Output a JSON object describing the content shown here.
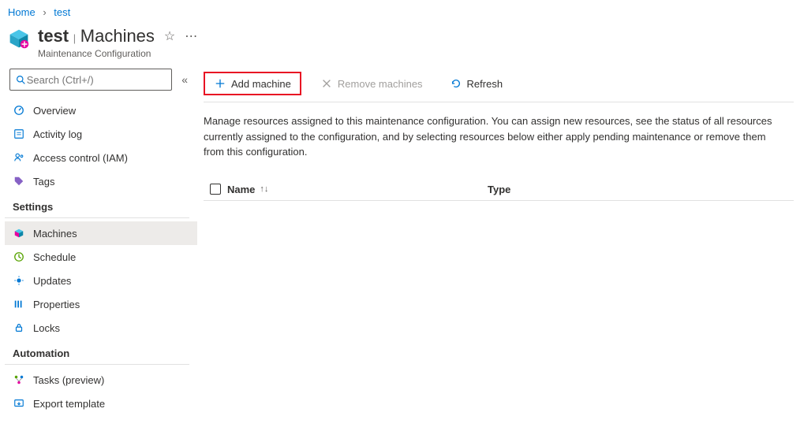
{
  "breadcrumb": {
    "home": "Home",
    "current": "test"
  },
  "header": {
    "resource_name": "test",
    "blade_name": "Machines",
    "subtitle": "Maintenance Configuration"
  },
  "search": {
    "placeholder": "Search (Ctrl+/)"
  },
  "sidebar": {
    "items": [
      {
        "label": "Overview"
      },
      {
        "label": "Activity log"
      },
      {
        "label": "Access control (IAM)"
      },
      {
        "label": "Tags"
      }
    ],
    "settings_label": "Settings",
    "settings_items": [
      {
        "label": "Machines"
      },
      {
        "label": "Schedule"
      },
      {
        "label": "Updates"
      },
      {
        "label": "Properties"
      },
      {
        "label": "Locks"
      }
    ],
    "automation_label": "Automation",
    "automation_items": [
      {
        "label": "Tasks (preview)"
      },
      {
        "label": "Export template"
      }
    ]
  },
  "toolbar": {
    "add_label": "Add machine",
    "remove_label": "Remove machines",
    "refresh_label": "Refresh"
  },
  "description_text": "Manage resources assigned to this maintenance configuration. You can assign new resources, see the status of all resources currently assigned to the configuration, and by selecting resources below either apply pending maintenance or remove them from this configuration.",
  "table": {
    "col_name": "Name",
    "col_type": "Type"
  }
}
